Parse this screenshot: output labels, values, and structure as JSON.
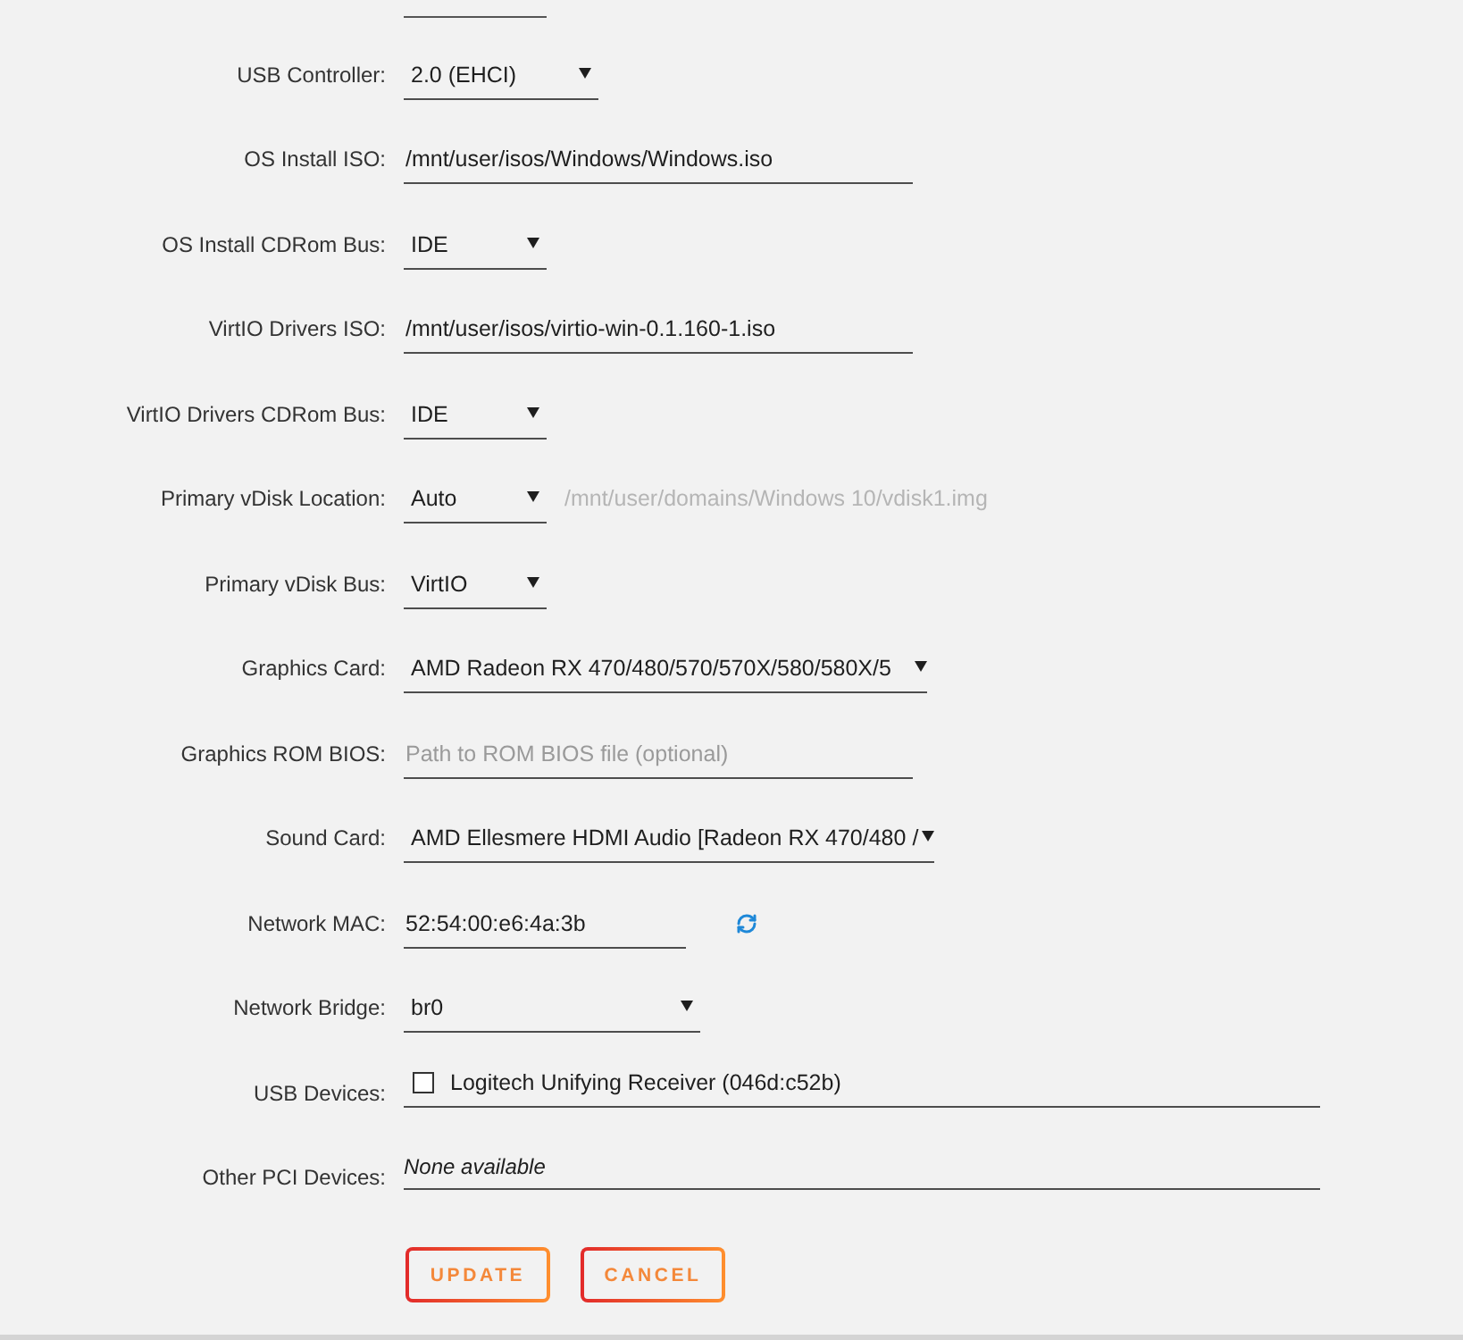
{
  "cut_off_field": {
    "kind": "select"
  },
  "fields": [
    {
      "label": "USB Controller:",
      "kind": "select",
      "value": "2.0 (EHCI)"
    },
    {
      "label": "OS Install ISO:",
      "kind": "text",
      "value": "/mnt/user/isos/Windows/Windows.iso"
    },
    {
      "label": "OS Install CDRom Bus:",
      "kind": "select",
      "value": "IDE"
    },
    {
      "label": "VirtIO Drivers ISO:",
      "kind": "text",
      "value": "/mnt/user/isos/virtio-win-0.1.160-1.iso"
    },
    {
      "label": "VirtIO Drivers CDRom Bus:",
      "kind": "select",
      "value": "IDE"
    },
    {
      "label": "Primary vDisk Location:",
      "kind": "select",
      "value": "Auto",
      "path": "/mnt/user/domains/Windows 10/vdisk1.img"
    },
    {
      "label": "Primary vDisk Bus:",
      "kind": "select",
      "value": "VirtIO"
    },
    {
      "label": "Graphics Card:",
      "kind": "select",
      "value": "AMD Radeon RX 470/480/570/570X/580/580X/5"
    },
    {
      "label": "Graphics ROM BIOS:",
      "kind": "text",
      "placeholder": "Path to ROM BIOS file (optional)"
    },
    {
      "label": "Sound Card:",
      "kind": "select",
      "value": "AMD Ellesmere HDMI Audio [Radeon RX 470/480 /"
    },
    {
      "label": "Network MAC:",
      "kind": "text",
      "value": "52:54:00:e6:4a:3b",
      "refresh": true
    },
    {
      "label": "Network Bridge:",
      "kind": "select",
      "value": "br0"
    },
    {
      "label": "USB Devices:",
      "kind": "checklist",
      "items": [
        {
          "label": "Logitech Unifying Receiver (046d:c52b)",
          "checked": false
        }
      ]
    },
    {
      "label": "Other PCI Devices:",
      "kind": "note",
      "text": "None available"
    }
  ],
  "buttons": [
    {
      "label": "UPDATE"
    },
    {
      "label": "CANCEL"
    }
  ]
}
